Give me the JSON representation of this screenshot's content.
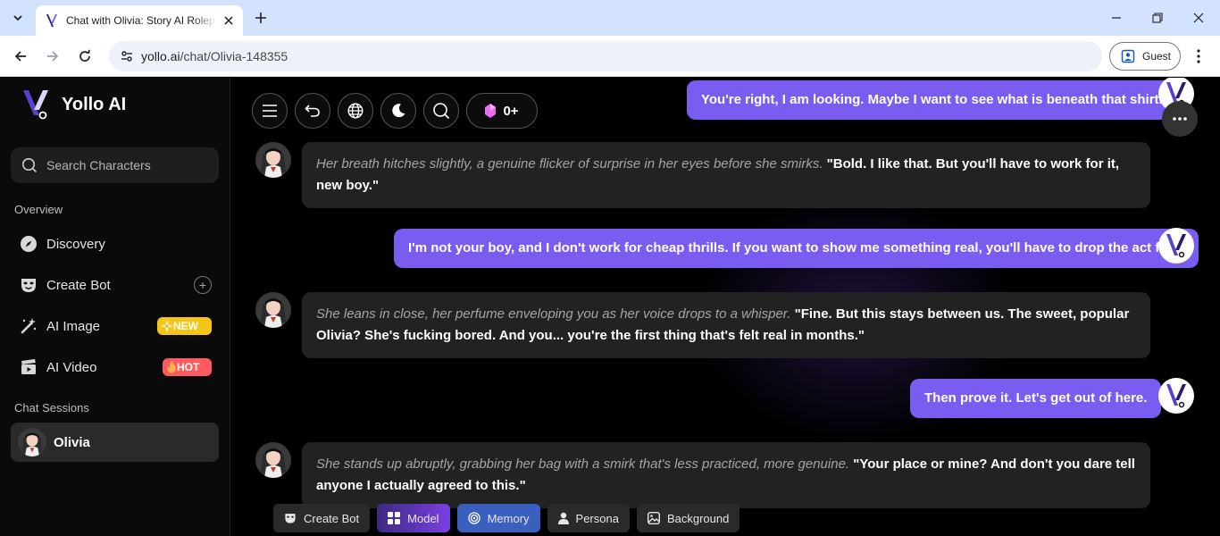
{
  "browser": {
    "tab_title": "Chat with Olivia: Story AI Roleplay",
    "url_host": "yollo.ai",
    "url_path": "/chat/Olivia-148355",
    "profile_label": "Guest"
  },
  "sidebar": {
    "brand": "Yollo AI",
    "search_placeholder": "Search Characters",
    "overview_label": "Overview",
    "items": [
      {
        "label": "Discovery",
        "icon": "compass-icon"
      },
      {
        "label": "Create Bot",
        "icon": "mask-icon"
      },
      {
        "label": "AI Image",
        "icon": "magic-wand-icon",
        "badge": "NEW"
      },
      {
        "label": "AI Video",
        "icon": "clapperboard-icon",
        "badge": "HOT"
      }
    ],
    "sessions_label": "Chat Sessions",
    "sessions": [
      {
        "label": "Olivia"
      }
    ]
  },
  "toolbar": {
    "gem_count": "0+"
  },
  "messages": [
    {
      "role": "user",
      "text": "You're right, I am looking. Maybe I want to see what is beneath that shirt."
    },
    {
      "role": "bot",
      "action": "Her breath hitches slightly, a genuine flicker of surprise in her eyes before she smirks.",
      "speech": "\"Bold. I like that. But you'll have to work for it, new boy.\""
    },
    {
      "role": "user",
      "text": "I'm not your boy, and I don't work for cheap thrills. If you want to show me something real, you'll have to drop the act first."
    },
    {
      "role": "bot",
      "action": "She leans in close, her perfume enveloping you as her voice drops to a whisper.",
      "speech": "\"Fine. But this stays between us. The sweet, popular Olivia? She's fucking bored. And you... you're the first thing that's felt real in months.\""
    },
    {
      "role": "user",
      "text": "Then prove it. Let's get out of here."
    },
    {
      "role": "bot",
      "action": "She stands up abruptly, grabbing her bag with a smirk that's less practiced, more genuine.",
      "speech": "\"Your place or mine? And don't you dare tell anyone I actually agreed to this.\""
    }
  ],
  "bottom_actions": [
    {
      "label": "Create Bot"
    },
    {
      "label": "Model"
    },
    {
      "label": "Memory"
    },
    {
      "label": "Persona"
    },
    {
      "label": "Background"
    }
  ],
  "colors": {
    "accent": "#7b5cf0",
    "bot_bubble": "#222222",
    "new_badge": "#f5c518",
    "hot_badge": "#ff5a5f"
  }
}
